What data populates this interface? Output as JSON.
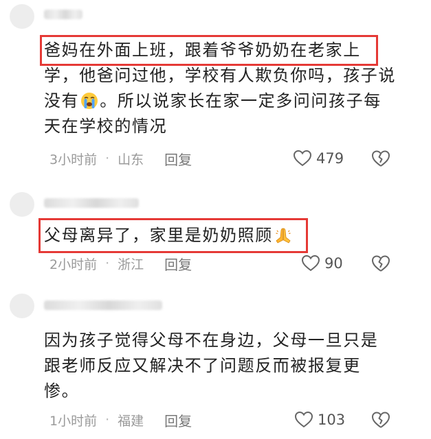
{
  "comments": [
    {
      "lines": [
        "爸妈在外面上班，跟着爷爷奶奶在老家上",
        "学，他爸问过他，学校有人欺负你吗，孩子说",
        "没有",
        "。所以说家长在家一定多问问孩子每",
        "天在学校的情况"
      ],
      "emoji": "crying-face",
      "time": "3小时前",
      "dot": "·",
      "location": "山东",
      "reply": "回复",
      "likes": "479"
    },
    {
      "lines": [
        "父母离异了，家里是奶奶照顾"
      ],
      "emoji": "folded-hands",
      "time": "2小时前",
      "dot": "·",
      "location": "浙江",
      "reply": "回复",
      "likes": "90"
    },
    {
      "lines": [
        "因为孩子觉得父母不在身边，父母一旦只是",
        "跟老师反应又解决不了问题反而被报复更",
        "惨。"
      ],
      "time": "1小时前",
      "dot": "·",
      "location": "福建",
      "reply": "回复",
      "likes": "103"
    }
  ],
  "colors": {
    "highlight": "#e53935",
    "text": "#222222",
    "meta": "#9a9a9a"
  }
}
